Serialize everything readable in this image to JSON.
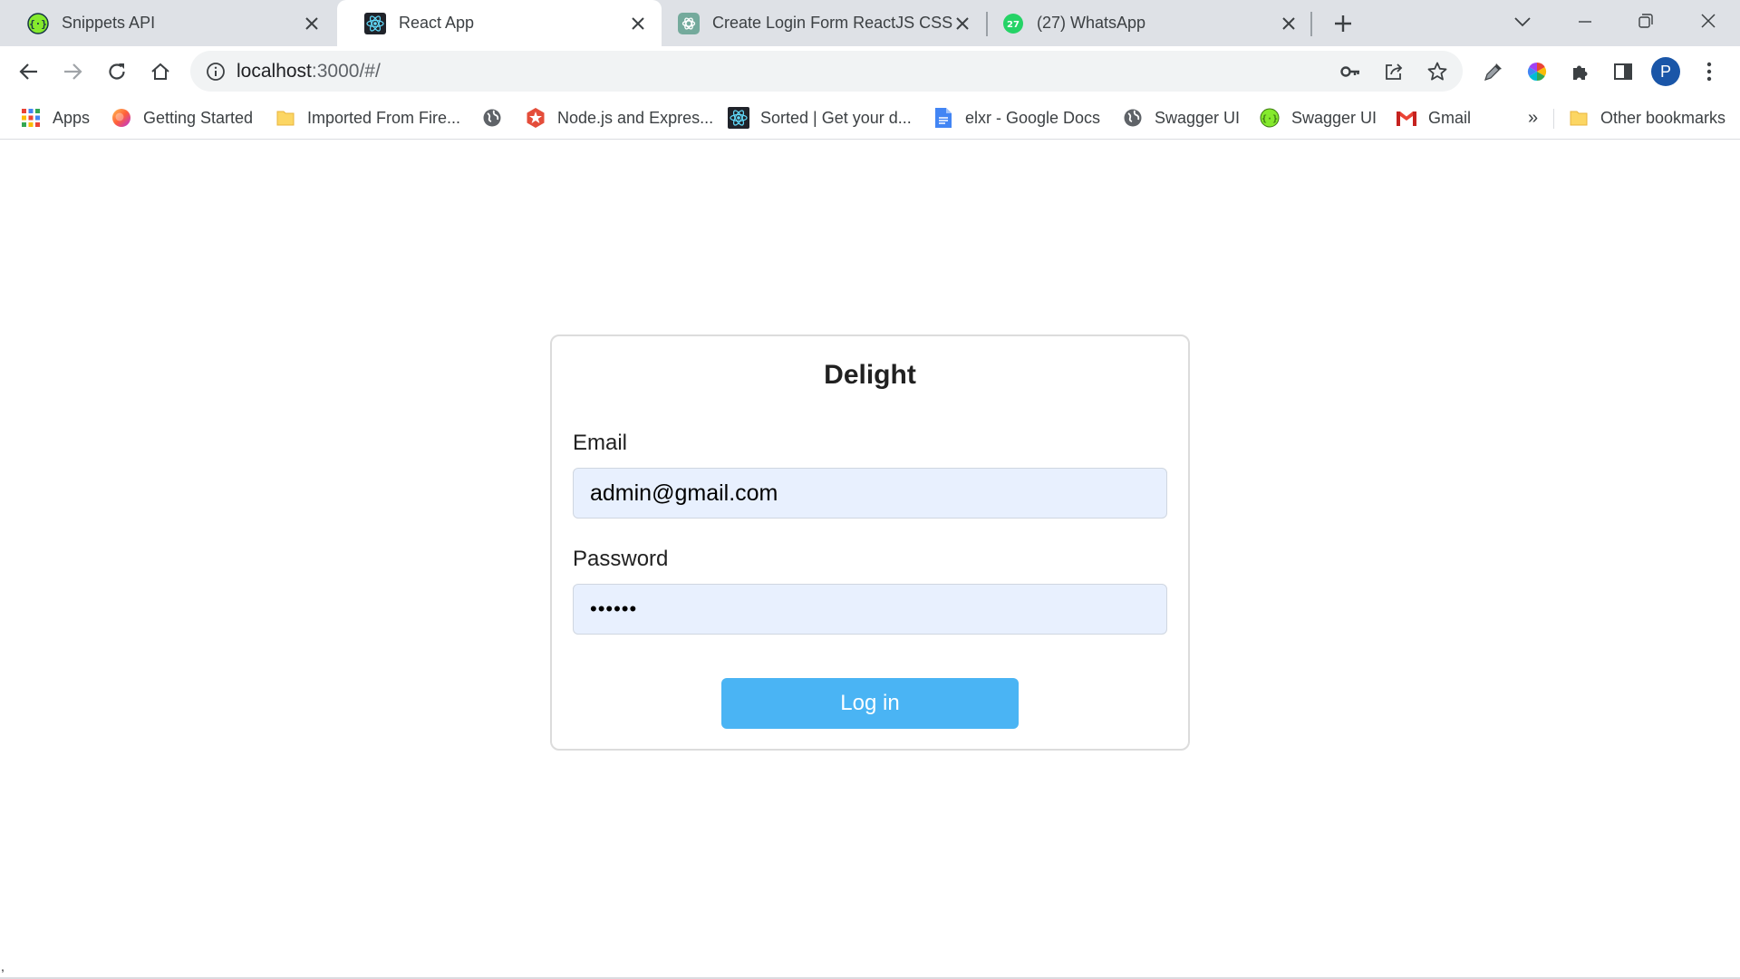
{
  "browser": {
    "tabs": [
      {
        "title": "Snippets API",
        "favicon": "swagger-icon",
        "active": false
      },
      {
        "title": "React App",
        "favicon": "react-icon",
        "active": true
      },
      {
        "title": "Create Login Form ReactJS CSS",
        "favicon": "chatgpt-icon",
        "active": false
      },
      {
        "title": "(27) WhatsApp",
        "favicon": "whatsapp-icon",
        "badge": "27",
        "active": false
      }
    ],
    "address": {
      "host": "localhost",
      "path": ":3000/#/"
    },
    "profile_initial": "P",
    "bookmarks": [
      {
        "label": "Apps",
        "icon": "apps-grid-icon"
      },
      {
        "label": "Getting Started",
        "icon": "firefox-icon"
      },
      {
        "label": "Imported From Fire...",
        "icon": "folder-icon"
      },
      {
        "label": "",
        "icon": "globe-icon"
      },
      {
        "label": "Node.js and Expres...",
        "icon": "node-icon"
      },
      {
        "label": "Sorted | Get your d...",
        "icon": "react-icon"
      },
      {
        "label": "elxr - Google Docs",
        "icon": "google-docs-icon"
      },
      {
        "label": "Swagger UI",
        "icon": "globe-icon"
      },
      {
        "label": "Swagger UI",
        "icon": "swagger-icon"
      },
      {
        "label": "Gmail",
        "icon": "gmail-icon"
      }
    ],
    "bookmarks_overflow": "»",
    "other_bookmarks": "Other bookmarks"
  },
  "colors": {
    "accent": "#4ab4f4",
    "input_bg": "#e8f0fe",
    "tabstrip_bg": "#dee1e6",
    "profile_bg": "#1a56a8"
  },
  "login": {
    "title": "Delight",
    "email_label": "Email",
    "email_value": "admin@gmail.com",
    "password_label": "Password",
    "password_value": "••••••",
    "submit_label": "Log in"
  },
  "footer": {
    "corner_mark": ","
  }
}
